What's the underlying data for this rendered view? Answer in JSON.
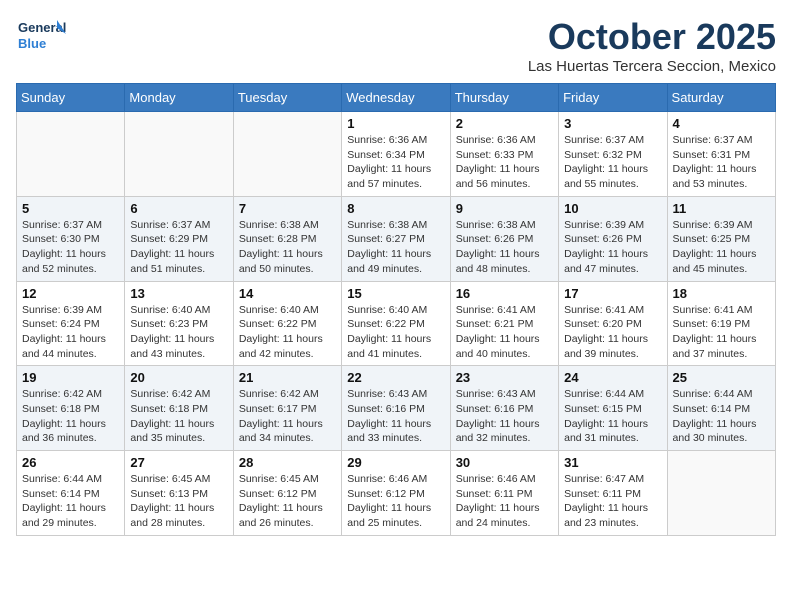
{
  "logo": {
    "line1": "General",
    "line2": "Blue"
  },
  "header": {
    "month": "October 2025",
    "location": "Las Huertas Tercera Seccion, Mexico"
  },
  "days_of_week": [
    "Sunday",
    "Monday",
    "Tuesday",
    "Wednesday",
    "Thursday",
    "Friday",
    "Saturday"
  ],
  "weeks": [
    [
      {
        "day": "",
        "info": ""
      },
      {
        "day": "",
        "info": ""
      },
      {
        "day": "",
        "info": ""
      },
      {
        "day": "1",
        "info": "Sunrise: 6:36 AM\nSunset: 6:34 PM\nDaylight: 11 hours and 57 minutes."
      },
      {
        "day": "2",
        "info": "Sunrise: 6:36 AM\nSunset: 6:33 PM\nDaylight: 11 hours and 56 minutes."
      },
      {
        "day": "3",
        "info": "Sunrise: 6:37 AM\nSunset: 6:32 PM\nDaylight: 11 hours and 55 minutes."
      },
      {
        "day": "4",
        "info": "Sunrise: 6:37 AM\nSunset: 6:31 PM\nDaylight: 11 hours and 53 minutes."
      }
    ],
    [
      {
        "day": "5",
        "info": "Sunrise: 6:37 AM\nSunset: 6:30 PM\nDaylight: 11 hours and 52 minutes."
      },
      {
        "day": "6",
        "info": "Sunrise: 6:37 AM\nSunset: 6:29 PM\nDaylight: 11 hours and 51 minutes."
      },
      {
        "day": "7",
        "info": "Sunrise: 6:38 AM\nSunset: 6:28 PM\nDaylight: 11 hours and 50 minutes."
      },
      {
        "day": "8",
        "info": "Sunrise: 6:38 AM\nSunset: 6:27 PM\nDaylight: 11 hours and 49 minutes."
      },
      {
        "day": "9",
        "info": "Sunrise: 6:38 AM\nSunset: 6:26 PM\nDaylight: 11 hours and 48 minutes."
      },
      {
        "day": "10",
        "info": "Sunrise: 6:39 AM\nSunset: 6:26 PM\nDaylight: 11 hours and 47 minutes."
      },
      {
        "day": "11",
        "info": "Sunrise: 6:39 AM\nSunset: 6:25 PM\nDaylight: 11 hours and 45 minutes."
      }
    ],
    [
      {
        "day": "12",
        "info": "Sunrise: 6:39 AM\nSunset: 6:24 PM\nDaylight: 11 hours and 44 minutes."
      },
      {
        "day": "13",
        "info": "Sunrise: 6:40 AM\nSunset: 6:23 PM\nDaylight: 11 hours and 43 minutes."
      },
      {
        "day": "14",
        "info": "Sunrise: 6:40 AM\nSunset: 6:22 PM\nDaylight: 11 hours and 42 minutes."
      },
      {
        "day": "15",
        "info": "Sunrise: 6:40 AM\nSunset: 6:22 PM\nDaylight: 11 hours and 41 minutes."
      },
      {
        "day": "16",
        "info": "Sunrise: 6:41 AM\nSunset: 6:21 PM\nDaylight: 11 hours and 40 minutes."
      },
      {
        "day": "17",
        "info": "Sunrise: 6:41 AM\nSunset: 6:20 PM\nDaylight: 11 hours and 39 minutes."
      },
      {
        "day": "18",
        "info": "Sunrise: 6:41 AM\nSunset: 6:19 PM\nDaylight: 11 hours and 37 minutes."
      }
    ],
    [
      {
        "day": "19",
        "info": "Sunrise: 6:42 AM\nSunset: 6:18 PM\nDaylight: 11 hours and 36 minutes."
      },
      {
        "day": "20",
        "info": "Sunrise: 6:42 AM\nSunset: 6:18 PM\nDaylight: 11 hours and 35 minutes."
      },
      {
        "day": "21",
        "info": "Sunrise: 6:42 AM\nSunset: 6:17 PM\nDaylight: 11 hours and 34 minutes."
      },
      {
        "day": "22",
        "info": "Sunrise: 6:43 AM\nSunset: 6:16 PM\nDaylight: 11 hours and 33 minutes."
      },
      {
        "day": "23",
        "info": "Sunrise: 6:43 AM\nSunset: 6:16 PM\nDaylight: 11 hours and 32 minutes."
      },
      {
        "day": "24",
        "info": "Sunrise: 6:44 AM\nSunset: 6:15 PM\nDaylight: 11 hours and 31 minutes."
      },
      {
        "day": "25",
        "info": "Sunrise: 6:44 AM\nSunset: 6:14 PM\nDaylight: 11 hours and 30 minutes."
      }
    ],
    [
      {
        "day": "26",
        "info": "Sunrise: 6:44 AM\nSunset: 6:14 PM\nDaylight: 11 hours and 29 minutes."
      },
      {
        "day": "27",
        "info": "Sunrise: 6:45 AM\nSunset: 6:13 PM\nDaylight: 11 hours and 28 minutes."
      },
      {
        "day": "28",
        "info": "Sunrise: 6:45 AM\nSunset: 6:12 PM\nDaylight: 11 hours and 26 minutes."
      },
      {
        "day": "29",
        "info": "Sunrise: 6:46 AM\nSunset: 6:12 PM\nDaylight: 11 hours and 25 minutes."
      },
      {
        "day": "30",
        "info": "Sunrise: 6:46 AM\nSunset: 6:11 PM\nDaylight: 11 hours and 24 minutes."
      },
      {
        "day": "31",
        "info": "Sunrise: 6:47 AM\nSunset: 6:11 PM\nDaylight: 11 hours and 23 minutes."
      },
      {
        "day": "",
        "info": ""
      }
    ]
  ]
}
